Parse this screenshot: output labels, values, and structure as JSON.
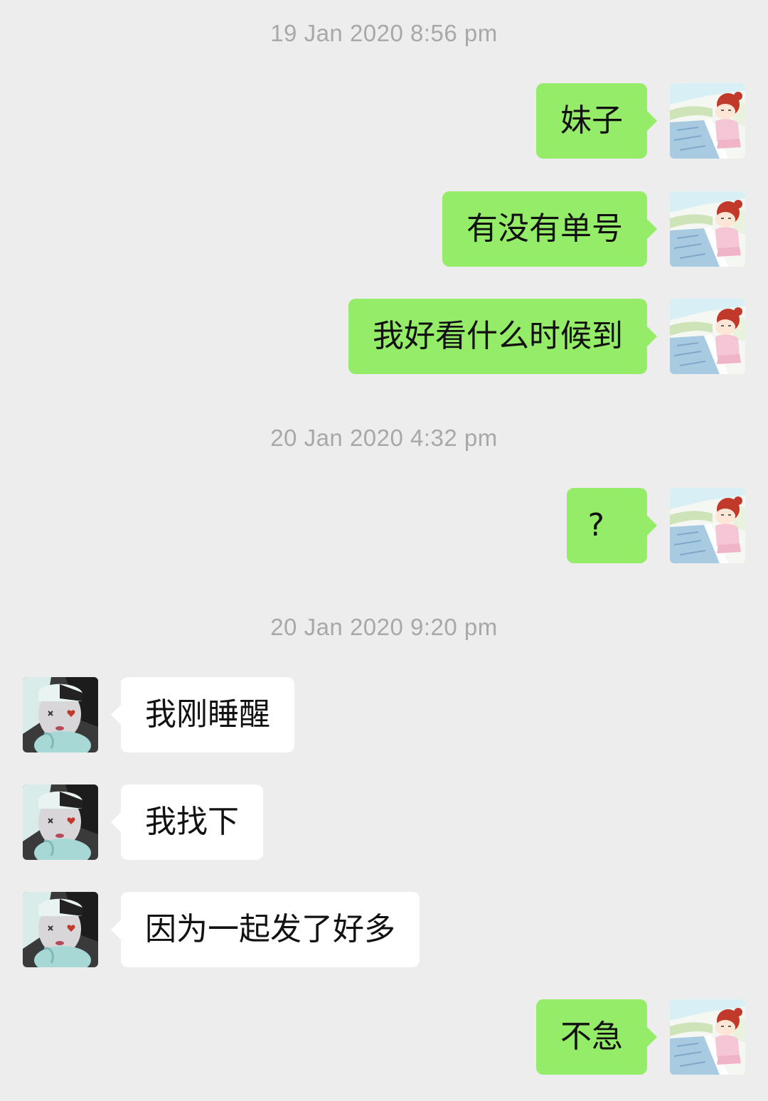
{
  "chat": {
    "timestamps": [
      "19 Jan 2020 8:56 pm",
      "20 Jan 2020 4:32 pm",
      "20 Jan 2020 9:20 pm"
    ],
    "messages": [
      {
        "sender": "me",
        "text": "妹子",
        "avatar": "cartoon-girl-avatar"
      },
      {
        "sender": "me",
        "text": "有没有单号",
        "avatar": "cartoon-girl-avatar"
      },
      {
        "sender": "me",
        "text": "我好看什么时候到",
        "avatar": "cartoon-girl-avatar"
      },
      {
        "sender": "me",
        "text": "?",
        "avatar": "cartoon-girl-avatar"
      },
      {
        "sender": "them",
        "text": "我刚睡醒",
        "avatar": "cosplay-girl-avatar"
      },
      {
        "sender": "them",
        "text": "我找下",
        "avatar": "cosplay-girl-avatar"
      },
      {
        "sender": "them",
        "text": "因为一起发了好多",
        "avatar": "cosplay-girl-avatar"
      },
      {
        "sender": "me",
        "text": "不急",
        "avatar": "cartoon-girl-avatar"
      }
    ]
  },
  "colors": {
    "background": "#ededed",
    "my_bubble": "#95ec69",
    "their_bubble": "#ffffff",
    "timestamp_text": "#a8a8a8"
  }
}
